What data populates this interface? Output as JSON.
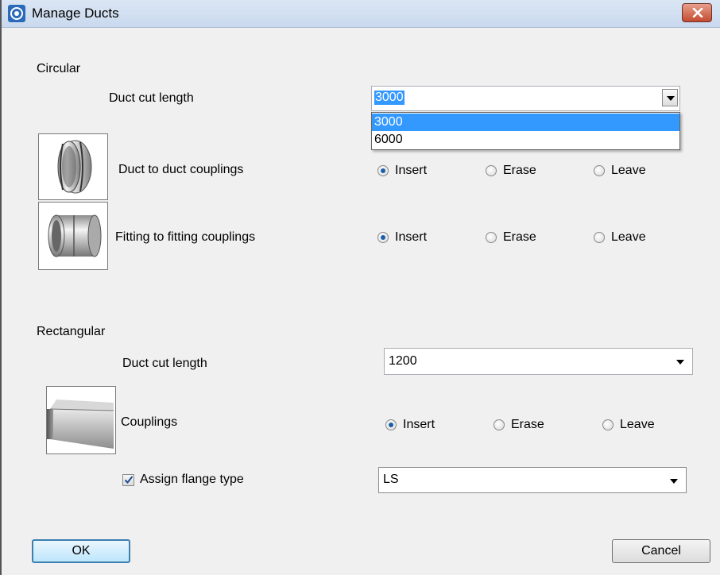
{
  "window": {
    "title": "Manage Ducts"
  },
  "circular": {
    "section_label": "Circular",
    "duct_cut_length": {
      "label": "Duct cut length",
      "value": "3000",
      "options": [
        "3000",
        "6000"
      ],
      "highlighted_option": "3000"
    },
    "duct_to_duct": {
      "label": "Duct to duct couplings",
      "options": [
        "Insert",
        "Erase",
        "Leave"
      ],
      "selected": "Insert"
    },
    "fitting_to_fitting": {
      "label": "Fitting to fitting couplings",
      "options": [
        "Insert",
        "Erase",
        "Leave"
      ],
      "selected": "Insert"
    }
  },
  "rectangular": {
    "section_label": "Rectangular",
    "duct_cut_length": {
      "label": "Duct cut length",
      "value": "1200"
    },
    "couplings": {
      "label": "Couplings",
      "options": [
        "Insert",
        "Erase",
        "Leave"
      ],
      "selected": "Insert"
    },
    "flange": {
      "label": "Assign flange type",
      "checked": true,
      "value": "LS"
    }
  },
  "buttons": {
    "ok": "OK",
    "cancel": "Cancel"
  },
  "icons": {
    "app": "manage-ducts-app-icon",
    "close": "close-icon",
    "dropdown": "chevron-down-icon",
    "radio": "radio-button-icon",
    "check": "checkmark-icon"
  },
  "colors": {
    "selection": "#3399ff",
    "close_button": "#c44a31",
    "title_bar": "#c9d9ee"
  }
}
